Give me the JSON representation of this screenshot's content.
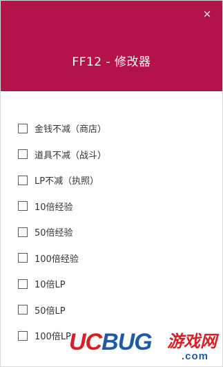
{
  "window": {
    "title": "FF12 - 修改器",
    "close_glyph": "×",
    "accent_color": "#b3124b"
  },
  "options": [
    {
      "label": "金钱不减（商店）",
      "checked": false
    },
    {
      "label": "道具不减（战斗）",
      "checked": false
    },
    {
      "label": "LP不减（执照）",
      "checked": false
    },
    {
      "label": "10倍经验",
      "checked": false
    },
    {
      "label": "50倍经验",
      "checked": false
    },
    {
      "label": "100倍经验",
      "checked": false
    },
    {
      "label": "10倍LP",
      "checked": false
    },
    {
      "label": "50倍LP",
      "checked": false
    },
    {
      "label": "100倍LP",
      "checked": false
    }
  ],
  "watermark": {
    "brand_uc": "UC",
    "brand_bug": "BUG",
    "brand_cn": "游戏网",
    "domain": ".com"
  }
}
